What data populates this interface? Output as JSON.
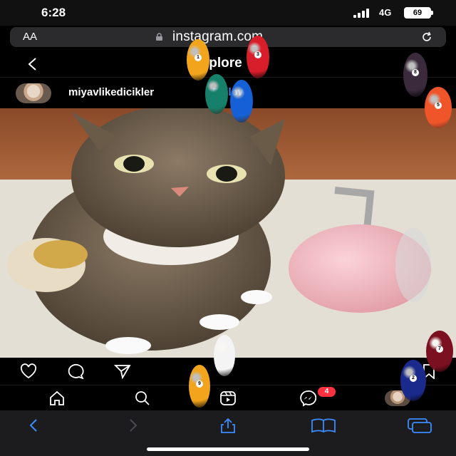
{
  "status_bar": {
    "time": "6:28",
    "network": "4G",
    "battery": "69"
  },
  "browser": {
    "text_size_button": "AA",
    "url": "instagram.com"
  },
  "header": {
    "title": "Explore"
  },
  "post": {
    "username": "miyavlikedicikler",
    "follow_label": "Follow"
  },
  "tab_bar": {
    "messages_badge": "4"
  },
  "balls": [
    {
      "color": "#f2a51c",
      "number": "1"
    },
    {
      "color": "#d81e2a",
      "number": "3"
    },
    {
      "color": "#16806a",
      "number": ""
    },
    {
      "color": "#1560d6",
      "number": ""
    },
    {
      "color": "#3a2a3c",
      "number": "8"
    },
    {
      "color": "#f0552a",
      "number": "5"
    },
    {
      "color": "#f4f4f4",
      "number": ""
    },
    {
      "color": "#f2a51c",
      "number": "9"
    },
    {
      "color": "#1a2a8c",
      "number": "2"
    },
    {
      "color": "#7a1020",
      "number": "7"
    }
  ],
  "colors": {
    "accent_blue": "#3b82f6",
    "badge_red": "#ff3040",
    "safari_blue": "#3d8bff"
  }
}
